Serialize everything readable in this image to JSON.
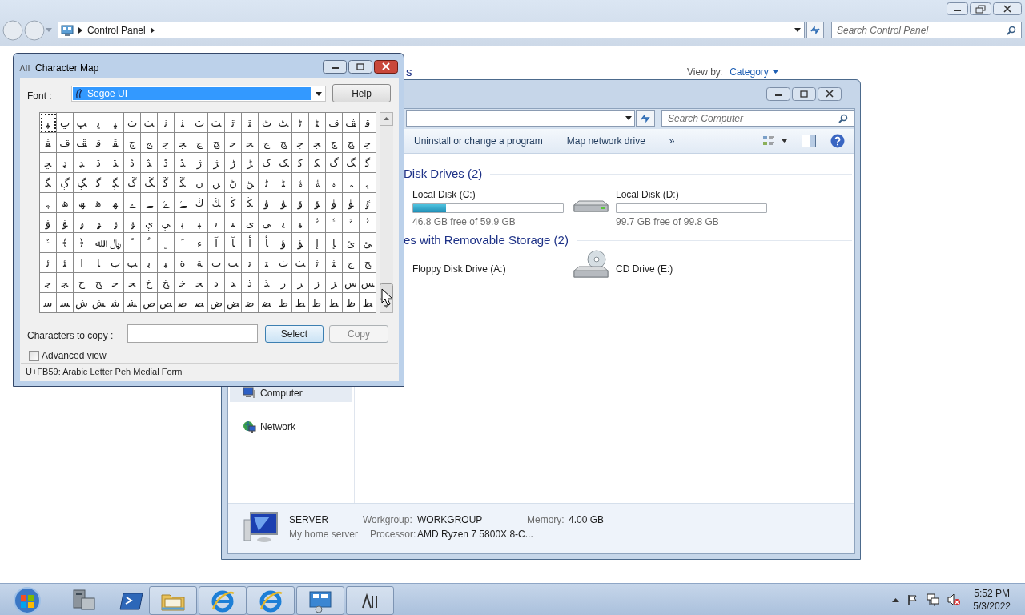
{
  "control_panel": {
    "address": [
      "Control Panel"
    ],
    "search_placeholder": "Search Control Panel",
    "heading_fragment": "s",
    "view_by_label": "View by:",
    "view_by_value": "Category"
  },
  "computer": {
    "search_placeholder": "Search Computer",
    "toolbar": [
      "Uninstall or change a program",
      "Map network drive",
      "»"
    ],
    "groups": [
      {
        "title": "Disk Drives (2)",
        "items": [
          {
            "kind": "disk",
            "name": "Local Disk (C:)",
            "level": 0.22,
            "free": "46.8 GB free of 59.9 GB"
          },
          {
            "kind": "disk",
            "name": "Local Disk (D:)",
            "level": 0.001,
            "free": "99.7 GB free of 99.8 GB"
          }
        ]
      },
      {
        "title": "es with Removable Storage (2)",
        "items": [
          {
            "kind": "floppy",
            "name": "Floppy Disk Drive (A:)"
          },
          {
            "kind": "cd",
            "name": "CD Drive (E:)"
          }
        ]
      }
    ],
    "nav": [
      {
        "kind": "computer",
        "label": "Computer",
        "selected": true
      },
      {
        "kind": "network",
        "label": "Network",
        "selected": false
      }
    ],
    "details": {
      "name": "SERVER",
      "description": "My home server",
      "fields": [
        {
          "label": "Workgroup:",
          "value": "WORKGROUP"
        },
        {
          "label": "Memory:",
          "value": "4.00 GB"
        },
        {
          "label": "Processor:",
          "value": "AMD Ryzen 7 5800X 8-C..."
        }
      ]
    }
  },
  "charmap": {
    "title": "Character Map",
    "font_label": "Font :",
    "font": "Segoe UI",
    "help": "Help",
    "rows": [
      {
        "cells": [
          {
            "ch": "ﭙ",
            "selected": true
          },
          {
            "ch": "ﭚ",
            "selected": false
          },
          {
            "ch": "ﭛ",
            "selected": false
          },
          {
            "ch": "ﭜ",
            "selected": false
          },
          {
            "ch": "ﭝ",
            "selected": false
          },
          {
            "ch": "ﭞ",
            "selected": false
          },
          {
            "ch": "ﭟ",
            "selected": false
          },
          {
            "ch": "ﭠ",
            "selected": false
          },
          {
            "ch": "ﭡ",
            "selected": false
          },
          {
            "ch": "ﭢ",
            "selected": false
          },
          {
            "ch": "ﭣ",
            "selected": false
          },
          {
            "ch": "ﭤ",
            "selected": false
          },
          {
            "ch": "ﭥ",
            "selected": false
          },
          {
            "ch": "ﭦ",
            "selected": false
          },
          {
            "ch": "ﭧ",
            "selected": false
          },
          {
            "ch": "ﭨ",
            "selected": false
          },
          {
            "ch": "ﭩ",
            "selected": false
          },
          {
            "ch": "ﭪ",
            "selected": false
          },
          {
            "ch": "ﭫ",
            "selected": false
          },
          {
            "ch": "ﭬ",
            "selected": false
          }
        ]
      },
      {
        "cells": [
          {
            "ch": "ﭭ",
            "selected": false
          },
          {
            "ch": "ﭮ",
            "selected": false
          },
          {
            "ch": "ﭯ",
            "selected": false
          },
          {
            "ch": "ﭰ",
            "selected": false
          },
          {
            "ch": "ﭱ",
            "selected": false
          },
          {
            "ch": "ﭲ",
            "selected": false
          },
          {
            "ch": "ﭳ",
            "selected": false
          },
          {
            "ch": "ﭴ",
            "selected": false
          },
          {
            "ch": "ﭵ",
            "selected": false
          },
          {
            "ch": "ﭶ",
            "selected": false
          },
          {
            "ch": "ﭷ",
            "selected": false
          },
          {
            "ch": "ﭸ",
            "selected": false
          },
          {
            "ch": "ﭹ",
            "selected": false
          },
          {
            "ch": "ﭺ",
            "selected": false
          },
          {
            "ch": "ﭻ",
            "selected": false
          },
          {
            "ch": "ﭼ",
            "selected": false
          },
          {
            "ch": "ﭽ",
            "selected": false
          },
          {
            "ch": "ﭾ",
            "selected": false
          },
          {
            "ch": "ﭿ",
            "selected": false
          },
          {
            "ch": "ﮀ",
            "selected": false
          }
        ]
      },
      {
        "cells": [
          {
            "ch": "ﮁ",
            "selected": false
          },
          {
            "ch": "ﮂ",
            "selected": false
          },
          {
            "ch": "ﮃ",
            "selected": false
          },
          {
            "ch": "ﮄ",
            "selected": false
          },
          {
            "ch": "ﮅ",
            "selected": false
          },
          {
            "ch": "ﮆ",
            "selected": false
          },
          {
            "ch": "ﮇ",
            "selected": false
          },
          {
            "ch": "ﮈ",
            "selected": false
          },
          {
            "ch": "ﮉ",
            "selected": false
          },
          {
            "ch": "ﮊ",
            "selected": false
          },
          {
            "ch": "ﮋ",
            "selected": false
          },
          {
            "ch": "ﮌ",
            "selected": false
          },
          {
            "ch": "ﮍ",
            "selected": false
          },
          {
            "ch": "ﮎ",
            "selected": false
          },
          {
            "ch": "ﮏ",
            "selected": false
          },
          {
            "ch": "ﮐ",
            "selected": false
          },
          {
            "ch": "ﮑ",
            "selected": false
          },
          {
            "ch": "ﮒ",
            "selected": false
          },
          {
            "ch": "ﮓ",
            "selected": false
          },
          {
            "ch": "ﮔ",
            "selected": false
          }
        ]
      },
      {
        "cells": [
          {
            "ch": "ﮕ",
            "selected": false
          },
          {
            "ch": "ﮖ",
            "selected": false
          },
          {
            "ch": "ﮗ",
            "selected": false
          },
          {
            "ch": "ﮘ",
            "selected": false
          },
          {
            "ch": "ﮙ",
            "selected": false
          },
          {
            "ch": "ﮚ",
            "selected": false
          },
          {
            "ch": "ﮛ",
            "selected": false
          },
          {
            "ch": "ﮜ",
            "selected": false
          },
          {
            "ch": "ﮝ",
            "selected": false
          },
          {
            "ch": "ﮞ",
            "selected": false
          },
          {
            "ch": "ﮟ",
            "selected": false
          },
          {
            "ch": "ﮠ",
            "selected": false
          },
          {
            "ch": "ﮡ",
            "selected": false
          },
          {
            "ch": "ﮢ",
            "selected": false
          },
          {
            "ch": "ﮣ",
            "selected": false
          },
          {
            "ch": "ﮤ",
            "selected": false
          },
          {
            "ch": "ﮥ",
            "selected": false
          },
          {
            "ch": "ﮦ",
            "selected": false
          },
          {
            "ch": "ﮧ",
            "selected": false
          },
          {
            "ch": "ﮨ",
            "selected": false
          }
        ]
      },
      {
        "cells": [
          {
            "ch": "ﮩ",
            "selected": false
          },
          {
            "ch": "ﮪ",
            "selected": false
          },
          {
            "ch": "ﮫ",
            "selected": false
          },
          {
            "ch": "ﮬ",
            "selected": false
          },
          {
            "ch": "ﮭ",
            "selected": false
          },
          {
            "ch": "ﮮ",
            "selected": false
          },
          {
            "ch": "ﮯ",
            "selected": false
          },
          {
            "ch": "ﮰ",
            "selected": false
          },
          {
            "ch": "ﮱ",
            "selected": false
          },
          {
            "ch": "ﯓ",
            "selected": false
          },
          {
            "ch": "ﯔ",
            "selected": false
          },
          {
            "ch": "ﯕ",
            "selected": false
          },
          {
            "ch": "ﯖ",
            "selected": false
          },
          {
            "ch": "ﯗ",
            "selected": false
          },
          {
            "ch": "ﯘ",
            "selected": false
          },
          {
            "ch": "ﯙ",
            "selected": false
          },
          {
            "ch": "ﯚ",
            "selected": false
          },
          {
            "ch": "ﯛ",
            "selected": false
          },
          {
            "ch": "ﯜ",
            "selected": false
          },
          {
            "ch": "ﯝ",
            "selected": false
          }
        ]
      },
      {
        "cells": [
          {
            "ch": "ﯞ",
            "selected": false
          },
          {
            "ch": "ﯟ",
            "selected": false
          },
          {
            "ch": "ﯠ",
            "selected": false
          },
          {
            "ch": "ﯡ",
            "selected": false
          },
          {
            "ch": "ﯢ",
            "selected": false
          },
          {
            "ch": "ﯣ",
            "selected": false
          },
          {
            "ch": "ﯤ",
            "selected": false
          },
          {
            "ch": "ﯥ",
            "selected": false
          },
          {
            "ch": "ﯦ",
            "selected": false
          },
          {
            "ch": "ﯧ",
            "selected": false
          },
          {
            "ch": "ﯨ",
            "selected": false
          },
          {
            "ch": "ﯩ",
            "selected": false
          },
          {
            "ch": "ﯼ",
            "selected": false
          },
          {
            "ch": "ﯽ",
            "selected": false
          },
          {
            "ch": "ﯾ",
            "selected": false
          },
          {
            "ch": "ﯿ",
            "selected": false
          },
          {
            "ch": "ﱞ",
            "selected": false
          },
          {
            "ch": "ﱟ",
            "selected": false
          },
          {
            "ch": "ﱠ",
            "selected": false
          },
          {
            "ch": "ﱡ",
            "selected": false
          }
        ]
      },
      {
        "cells": [
          {
            "ch": "ﱢ",
            "selected": false
          },
          {
            "ch": "﴾",
            "selected": false
          },
          {
            "ch": "﴿",
            "selected": false
          },
          {
            "ch": "ﷲ",
            "selected": false
          },
          {
            "ch": "﷼",
            "selected": false
          },
          {
            "ch": "ﹰ",
            "selected": false
          },
          {
            "ch": "ﹲ",
            "selected": false
          },
          {
            "ch": "ﹴ",
            "selected": false
          },
          {
            "ch": "ﹶ",
            "selected": false
          },
          {
            "ch": "ﺀ",
            "selected": false
          },
          {
            "ch": "ﺁ",
            "selected": false
          },
          {
            "ch": "ﺂ",
            "selected": false
          },
          {
            "ch": "ﺃ",
            "selected": false
          },
          {
            "ch": "ﺄ",
            "selected": false
          },
          {
            "ch": "ﺅ",
            "selected": false
          },
          {
            "ch": "ﺆ",
            "selected": false
          },
          {
            "ch": "ﺇ",
            "selected": false
          },
          {
            "ch": "ﺈ",
            "selected": false
          },
          {
            "ch": "ﺉ",
            "selected": false
          },
          {
            "ch": "ﺊ",
            "selected": false
          }
        ]
      },
      {
        "cells": [
          {
            "ch": "ﺋ",
            "selected": false
          },
          {
            "ch": "ﺌ",
            "selected": false
          },
          {
            "ch": "ﺍ",
            "selected": false
          },
          {
            "ch": "ﺎ",
            "selected": false
          },
          {
            "ch": "ﺏ",
            "selected": false
          },
          {
            "ch": "ﺐ",
            "selected": false
          },
          {
            "ch": "ﺑ",
            "selected": false
          },
          {
            "ch": "ﺒ",
            "selected": false
          },
          {
            "ch": "ﺓ",
            "selected": false
          },
          {
            "ch": "ﺔ",
            "selected": false
          },
          {
            "ch": "ﺕ",
            "selected": false
          },
          {
            "ch": "ﺖ",
            "selected": false
          },
          {
            "ch": "ﺗ",
            "selected": false
          },
          {
            "ch": "ﺘ",
            "selected": false
          },
          {
            "ch": "ﺙ",
            "selected": false
          },
          {
            "ch": "ﺚ",
            "selected": false
          },
          {
            "ch": "ﺛ",
            "selected": false
          },
          {
            "ch": "ﺜ",
            "selected": false
          },
          {
            "ch": "ﺝ",
            "selected": false
          },
          {
            "ch": "ﺞ",
            "selected": false
          }
        ]
      },
      {
        "cells": [
          {
            "ch": "ﺟ",
            "selected": false
          },
          {
            "ch": "ﺠ",
            "selected": false
          },
          {
            "ch": "ﺡ",
            "selected": false
          },
          {
            "ch": "ﺢ",
            "selected": false
          },
          {
            "ch": "ﺣ",
            "selected": false
          },
          {
            "ch": "ﺤ",
            "selected": false
          },
          {
            "ch": "ﺥ",
            "selected": false
          },
          {
            "ch": "ﺦ",
            "selected": false
          },
          {
            "ch": "ﺧ",
            "selected": false
          },
          {
            "ch": "ﺨ",
            "selected": false
          },
          {
            "ch": "ﺩ",
            "selected": false
          },
          {
            "ch": "ﺪ",
            "selected": false
          },
          {
            "ch": "ﺫ",
            "selected": false
          },
          {
            "ch": "ﺬ",
            "selected": false
          },
          {
            "ch": "ﺭ",
            "selected": false
          },
          {
            "ch": "ﺮ",
            "selected": false
          },
          {
            "ch": "ﺯ",
            "selected": false
          },
          {
            "ch": "ﺰ",
            "selected": false
          },
          {
            "ch": "ﺱ",
            "selected": false
          },
          {
            "ch": "ﺲ",
            "selected": false
          }
        ]
      },
      {
        "cells": [
          {
            "ch": "ﺳ",
            "selected": false
          },
          {
            "ch": "ﺴ",
            "selected": false
          },
          {
            "ch": "ﺵ",
            "selected": false
          },
          {
            "ch": "ﺶ",
            "selected": false
          },
          {
            "ch": "ﺷ",
            "selected": false
          },
          {
            "ch": "ﺸ",
            "selected": false
          },
          {
            "ch": "ﺹ",
            "selected": false
          },
          {
            "ch": "ﺺ",
            "selected": false
          },
          {
            "ch": "ﺻ",
            "selected": false
          },
          {
            "ch": "ﺼ",
            "selected": false
          },
          {
            "ch": "ﺽ",
            "selected": false
          },
          {
            "ch": "ﺾ",
            "selected": false
          },
          {
            "ch": "ﺿ",
            "selected": false
          },
          {
            "ch": "ﻀ",
            "selected": false
          },
          {
            "ch": "ﻁ",
            "selected": false
          },
          {
            "ch": "ﻂ",
            "selected": false
          },
          {
            "ch": "ﻃ",
            "selected": false
          },
          {
            "ch": "ﻄ",
            "selected": false
          },
          {
            "ch": "ﻅ",
            "selected": false
          },
          {
            "ch": "ﻆ",
            "selected": false
          }
        ]
      }
    ],
    "copy_label": "Characters to copy :",
    "select": "Select",
    "copy": {
      "label": "Copy",
      "disabled": true
    },
    "advanced": {
      "label": "Advanced view",
      "checked": false
    },
    "status": "U+FB59: Arabic Letter Peh Medial Form"
  },
  "taskbar": {
    "items": [
      {
        "kind": "server",
        "open": false
      },
      {
        "kind": "powershell",
        "open": false
      },
      {
        "kind": "folder",
        "open": true
      },
      {
        "kind": "ie",
        "open": true
      },
      {
        "kind": "ie",
        "open": true
      },
      {
        "kind": "panel",
        "open": true
      },
      {
        "kind": "charmap",
        "open": true
      }
    ],
    "time": "5:52 PM",
    "date": "5/3/2022"
  }
}
